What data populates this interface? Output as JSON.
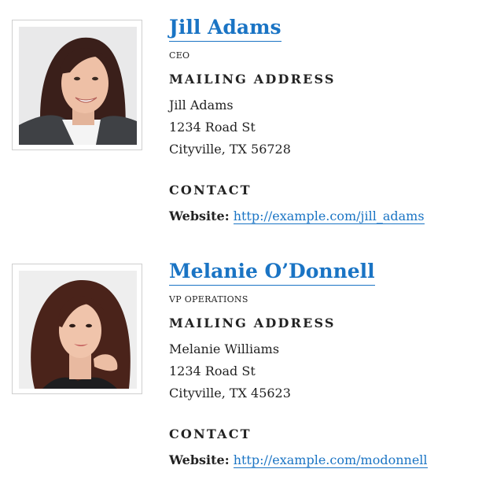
{
  "people": [
    {
      "name": "Jill Adams",
      "role": "CEO",
      "mailing_heading": "MAILING ADDRESS",
      "address": {
        "line1": "Jill Adams",
        "line2": "1234 Road St",
        "line3": "Cityville, TX 56728"
      },
      "contact_heading": "CONTACT",
      "website_label": "Website:",
      "website_url": "http://example.com/jill_adams"
    },
    {
      "name": "Melanie O’Donnell",
      "role": "VP OPERATIONS",
      "mailing_heading": "MAILING ADDRESS",
      "address": {
        "line1": "Melanie Williams",
        "line2": "1234 Road St",
        "line3": "Cityville, TX 45623"
      },
      "contact_heading": "CONTACT",
      "website_label": "Website:",
      "website_url": "http://example.com/modonnell"
    }
  ],
  "colors": {
    "link": "#1a74c4",
    "text": "#222222",
    "frame_border": "#cfcfcf"
  }
}
